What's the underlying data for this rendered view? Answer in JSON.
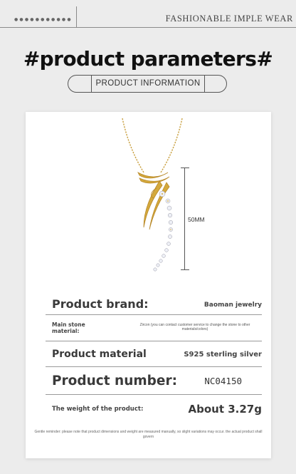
{
  "header": {
    "dots": "●●●●●●●●●●●",
    "brand_text": "FASHIONABLE IMPLE WEAR"
  },
  "page": {
    "title": "#product parameters#",
    "badge": "PRODUCT INFORMATION"
  },
  "product_image": {
    "dimension_label": "50MM",
    "colors": {
      "gold": "#d4a93c",
      "gold_dark": "#b8892a",
      "stone": "#eef0f6"
    }
  },
  "specs": {
    "brand": {
      "label": "Product brand:",
      "value": "Baoman jewelry"
    },
    "main_stone": {
      "label": "Main stone material:",
      "value": "Zircon (you can contact customer service to change the stone to other materials/colors)"
    },
    "material": {
      "label": "Product material",
      "value": "S925 sterling silver"
    },
    "number": {
      "label": "Product number:",
      "value": "NC04150"
    },
    "weight": {
      "label": "The weight of the product:",
      "value": "About 3.27g"
    }
  },
  "footer_note": "Gentle reminder: please note that product dimensions and weight are measured manually, so slight variations may occur. the actual product shall govern"
}
